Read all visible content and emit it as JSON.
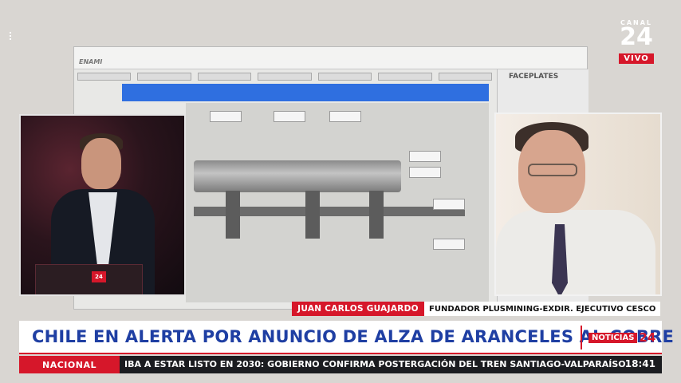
{
  "channel": {
    "canal": "CANAL",
    "number": "24",
    "live": "VIVO"
  },
  "background_screen": {
    "faceplates": "FACEPLATES"
  },
  "lower_third": {
    "name": "JUAN CARLOS GUAJARDO",
    "role": "FUNDADOR PLUSMINING-EXDIR. EJECUTIVO CESCO"
  },
  "headline": {
    "text": "CHILE EN ALERTA POR ANUNCIO DE ALZA DE ARANCELES AL COBRE",
    "brand_word": "NOTICIAS",
    "brand_num": "24"
  },
  "ticker": {
    "label": "NACIONAL",
    "text": "IBA A ESTAR LISTO EN 2030: GOBIERNO CONFIRMA POSTERGACIÓN DEL TREN SANTIAGO-VALPARAÍSO",
    "time": "18:41"
  },
  "colors": {
    "brand_red": "#d6172a",
    "headline_blue": "#1f3fa3",
    "ticker_dark": "#1b1c20"
  }
}
